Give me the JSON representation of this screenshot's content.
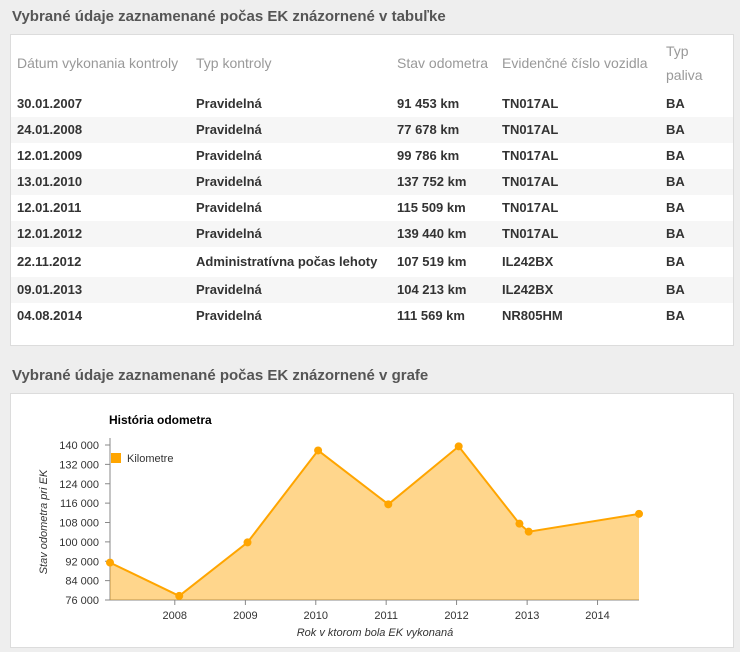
{
  "table_section": {
    "title": "Vybrané údaje zaznamenané počas EK znázornené v tabuľke",
    "columns": [
      "Dátum vykonania kontroly",
      "Typ kontroly",
      "Stav odometra",
      "Evidenčné číslo vozidla",
      "Typ paliva"
    ],
    "rows": [
      [
        "30.01.2007",
        "Pravidelná",
        "91 453 km",
        "TN017AL",
        "BA"
      ],
      [
        "24.01.2008",
        "Pravidelná",
        "77 678 km",
        "TN017AL",
        "BA"
      ],
      [
        "12.01.2009",
        "Pravidelná",
        "99 786 km",
        "TN017AL",
        "BA"
      ],
      [
        "13.01.2010",
        "Pravidelná",
        "137 752 km",
        "TN017AL",
        "BA"
      ],
      [
        "12.01.2011",
        "Pravidelná",
        "115 509 km",
        "TN017AL",
        "BA"
      ],
      [
        "12.01.2012",
        "Pravidelná",
        "139 440 km",
        "TN017AL",
        "BA"
      ],
      [
        "22.11.2012",
        "Administratívna počas lehoty",
        "107 519 km",
        "IL242BX",
        "BA"
      ],
      [
        "09.01.2013",
        "Pravidelná",
        "104 213 km",
        "IL242BX",
        "BA"
      ],
      [
        "04.08.2014",
        "Pravidelná",
        "111 569 km",
        "NR805HM",
        "BA"
      ]
    ]
  },
  "chart_section": {
    "title": "Vybrané údaje zaznamenané počas EK znázornené v grafe"
  },
  "chart_data": {
    "type": "area",
    "title": "História odometra",
    "xlabel": "Rok v ktorom bola EK vykonaná",
    "ylabel": "Stav odometra pri EK",
    "series": [
      {
        "name": "Kilometre",
        "color": "#ffa500",
        "points": [
          {
            "x": "2007-01-30",
            "y": 91453
          },
          {
            "x": "2008-01-24",
            "y": 77678
          },
          {
            "x": "2009-01-12",
            "y": 99786
          },
          {
            "x": "2010-01-13",
            "y": 137752
          },
          {
            "x": "2011-01-12",
            "y": 115509
          },
          {
            "x": "2012-01-12",
            "y": 139440
          },
          {
            "x": "2012-11-22",
            "y": 107519
          },
          {
            "x": "2013-01-09",
            "y": 104213
          },
          {
            "x": "2014-08-04",
            "y": 111569
          }
        ]
      }
    ],
    "x_ticks": [
      "2008",
      "2009",
      "2010",
      "2011",
      "2012",
      "2013",
      "2014"
    ],
    "y_ticks": [
      "76 000",
      "84 000",
      "92 000",
      "100 000",
      "108 000",
      "116 000",
      "124 000",
      "132 000",
      "140 000"
    ],
    "ylim": [
      76000,
      140000
    ],
    "legend_position": "top-left",
    "grid": false
  }
}
